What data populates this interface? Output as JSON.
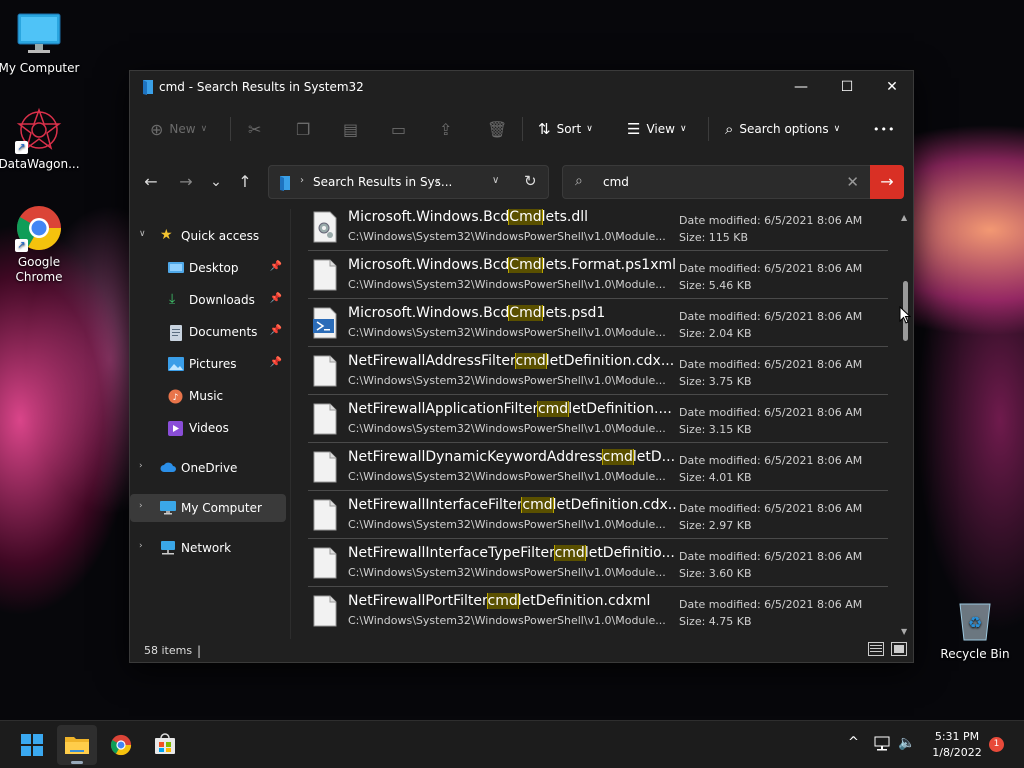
{
  "desktop": {
    "icons": [
      {
        "label": "My Computer",
        "icon": "monitor-icon"
      },
      {
        "label": "DataWagon...",
        "icon": "datawagon-icon"
      },
      {
        "label": "Google Chrome",
        "icon": "chrome-icon"
      },
      {
        "label": "Recycle Bin",
        "icon": "recycle-bin-icon"
      }
    ]
  },
  "window": {
    "title": "cmd - Search Results in System32",
    "minimize_glyph": "—",
    "maximize_glyph": "☐",
    "close_glyph": "✕"
  },
  "toolbar": {
    "new_label": "New",
    "sort_label": "Sort",
    "view_label": "View",
    "search_options_label": "Search options",
    "more_glyph": "•••"
  },
  "navigation": {
    "back_glyph": "←",
    "forward_glyph": "→",
    "recent_glyph": "⌄",
    "up_glyph": "↑",
    "address_text": "Search Results in Sys...",
    "refresh_glyph": "↻"
  },
  "search": {
    "query": "cmd",
    "clear_glyph": "✕",
    "go_glyph": "→"
  },
  "sidebar": {
    "quick_access_label": "Quick access",
    "items": [
      {
        "label": "Desktop",
        "pinned": true
      },
      {
        "label": "Downloads",
        "pinned": true
      },
      {
        "label": "Documents",
        "pinned": true
      },
      {
        "label": "Pictures",
        "pinned": true
      },
      {
        "label": "Music",
        "pinned": false
      },
      {
        "label": "Videos",
        "pinned": false
      }
    ],
    "onedrive_label": "OneDrive",
    "mycomputer_label": "My Computer",
    "network_label": "Network"
  },
  "results": [
    {
      "pre": "Microsoft.Windows.Bcd",
      "hl": "Cmd",
      "post": "lets.dll",
      "path": "C:\\Windows\\System32\\WindowsPowerShell\\v1.0\\Module...",
      "modified": "Date modified: 6/5/2021 8:06 AM",
      "size": "Size: 115 KB",
      "type": "dll"
    },
    {
      "pre": "Microsoft.Windows.Bcd",
      "hl": "Cmd",
      "post": "lets.Format.ps1xml",
      "path": "C:\\Windows\\System32\\WindowsPowerShell\\v1.0\\Module...",
      "modified": "Date modified: 6/5/2021 8:06 AM",
      "size": "Size: 5.46 KB",
      "type": "doc"
    },
    {
      "pre": "Microsoft.Windows.Bcd",
      "hl": "Cmd",
      "post": "lets.psd1",
      "path": "C:\\Windows\\System32\\WindowsPowerShell\\v1.0\\Module...",
      "modified": "Date modified: 6/5/2021 8:06 AM",
      "size": "Size: 2.04 KB",
      "type": "ps"
    },
    {
      "pre": "NetFirewallAddressFilter",
      "hl": "cmd",
      "post": "letDefinition.cdx...",
      "path": "C:\\Windows\\System32\\WindowsPowerShell\\v1.0\\Module...",
      "modified": "Date modified: 6/5/2021 8:06 AM",
      "size": "Size: 3.75 KB",
      "type": "doc"
    },
    {
      "pre": "NetFirewallApplicationFilter",
      "hl": "cmd",
      "post": "letDefinition....",
      "path": "C:\\Windows\\System32\\WindowsPowerShell\\v1.0\\Module...",
      "modified": "Date modified: 6/5/2021 8:06 AM",
      "size": "Size: 3.15 KB",
      "type": "doc"
    },
    {
      "pre": "NetFirewallDynamicKeywordAddress",
      "hl": "cmd",
      "post": "letD...",
      "path": "C:\\Windows\\System32\\WindowsPowerShell\\v1.0\\Module...",
      "modified": "Date modified: 6/5/2021 8:06 AM",
      "size": "Size: 4.01 KB",
      "type": "doc"
    },
    {
      "pre": "NetFirewallInterfaceFilter",
      "hl": "cmd",
      "post": "letDefinition.cdx...",
      "path": "C:\\Windows\\System32\\WindowsPowerShell\\v1.0\\Module...",
      "modified": "Date modified: 6/5/2021 8:06 AM",
      "size": "Size: 2.97 KB",
      "type": "doc"
    },
    {
      "pre": "NetFirewallInterfaceTypeFilter",
      "hl": "cmd",
      "post": "letDefinitio...",
      "path": "C:\\Windows\\System32\\WindowsPowerShell\\v1.0\\Module...",
      "modified": "Date modified: 6/5/2021 8:06 AM",
      "size": "Size: 3.60 KB",
      "type": "doc"
    },
    {
      "pre": "NetFirewallPortFilter",
      "hl": "cmd",
      "post": "letDefinition.cdxml",
      "path": "C:\\Windows\\System32\\WindowsPowerShell\\v1.0\\Module...",
      "modified": "Date modified: 6/5/2021 8:06 AM",
      "size": "Size: 4.75 KB",
      "type": "doc"
    }
  ],
  "status": {
    "item_count": "58 items"
  },
  "taskbar": {
    "time": "5:31 PM",
    "date": "1/8/2022",
    "notification_count": "1",
    "chevron_glyph": "^"
  },
  "colors": {
    "accent_search_go": "#d93025",
    "highlight_fill": "#5a5000",
    "highlight_border": "#b8a400",
    "window_bg": "#202020"
  }
}
